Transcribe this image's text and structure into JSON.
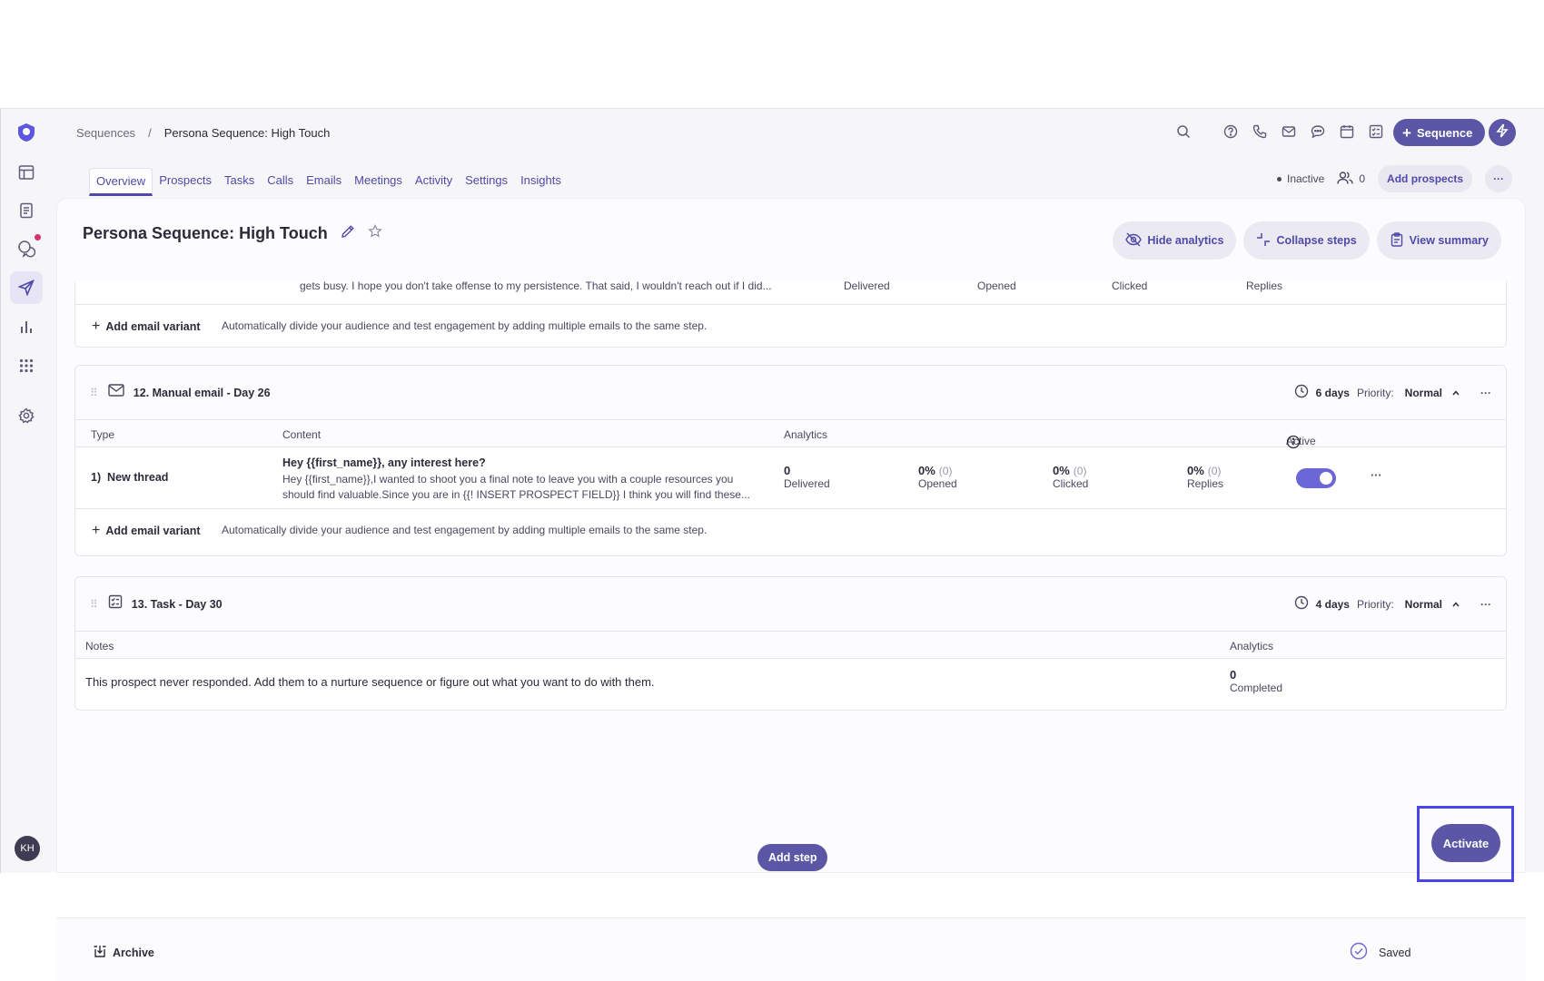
{
  "breadcrumb": {
    "root": "Sequences",
    "sep": "/",
    "current": "Persona Sequence: High Touch"
  },
  "header": {
    "new_sequence_label": "Sequence"
  },
  "tabs": [
    "Overview",
    "Prospects",
    "Tasks",
    "Calls",
    "Emails",
    "Meetings",
    "Activity",
    "Settings",
    "Insights"
  ],
  "status": {
    "state": "Inactive",
    "prospect_count": "0",
    "add_prospects_label": "Add prospects"
  },
  "page": {
    "title": "Persona Sequence: High Touch",
    "hide_analytics": "Hide analytics",
    "collapse_steps": "Collapse steps",
    "view_summary": "View summary"
  },
  "prev_step": {
    "cut_text": "gets busy. I hope you don't take offense to my persistence. That said, I wouldn't reach out if I did...",
    "cut_labels": [
      "Delivered",
      "Opened",
      "Clicked",
      "Replies"
    ],
    "variant_label": "Add email variant",
    "variant_desc": "Automatically divide your audience and test engagement by adding multiple emails to the same step."
  },
  "step12": {
    "title": "12. Manual email - Day 26",
    "delay": "6 days",
    "priority_label": "Priority:",
    "priority": "Normal",
    "headers": {
      "type": "Type",
      "content": "Content",
      "analytics": "Analytics",
      "active": "Active"
    },
    "row": {
      "type": "1)  New thread",
      "subject": "Hey {{first_name}}, any interest here?",
      "body1": "Hey {{first_name}},I wanted to shoot you a final note to leave you with a couple resources you",
      "body2": "should find valuable.Since you are in {{! INSERT PROSPECT FIELD}} I think you will find these...",
      "delivered_val": "0",
      "delivered_lbl": "Delivered",
      "opened_val": "0%",
      "opened_cnt": "(0)",
      "opened_lbl": "Opened",
      "clicked_val": "0%",
      "clicked_cnt": "(0)",
      "clicked_lbl": "Clicked",
      "replies_val": "0%",
      "replies_cnt": "(0)",
      "replies_lbl": "Replies",
      "active": true
    },
    "variant_label": "Add email variant",
    "variant_desc": "Automatically divide your audience and test engagement by adding multiple emails to the same step."
  },
  "step13": {
    "title": "13. Task - Day 30",
    "delay": "4 days",
    "priority_label": "Priority:",
    "priority": "Normal",
    "headers": {
      "notes": "Notes",
      "analytics": "Analytics"
    },
    "note": "This prospect never responded. Add them to a nurture sequence or figure out what you want to do with them.",
    "completed_val": "0",
    "completed_lbl": "Completed"
  },
  "add_step_label": "Add step",
  "footer": {
    "archive_label": "Archive",
    "saved_label": "Saved",
    "activate_label": "Activate"
  },
  "user": {
    "initials": "KH"
  },
  "colors": {
    "brand": "#5b57a6",
    "accent": "#4f4aa8",
    "toggle": "#6c67d6",
    "highlight": "#4b44e8"
  }
}
